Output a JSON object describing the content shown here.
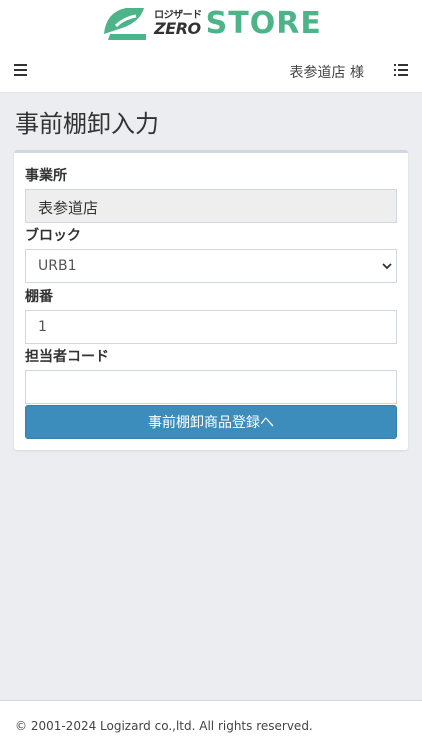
{
  "brand": {
    "logo_kana": "ロジザード",
    "logo_zero": "ZERO",
    "logo_store": "STORE",
    "accent_color": "#4db48a"
  },
  "navbar": {
    "menu_icon": "hamburger-icon",
    "user_label": "表参道店 様",
    "list_icon": "list-icon"
  },
  "page": {
    "title": "事前棚卸入力"
  },
  "form": {
    "office_label": "事業所",
    "office_value": "表参道店",
    "block_label": "ブロック",
    "block_selected": "URB1",
    "shelf_label": "棚番",
    "shelf_value": "1",
    "staff_label": "担当者コード",
    "staff_value": "",
    "submit_label": "事前棚卸商品登録へ",
    "button_color": "#3c8dbc"
  },
  "footer": {
    "copyright": "© 2001-2024 Logizard co.,ltd. All rights reserved."
  }
}
